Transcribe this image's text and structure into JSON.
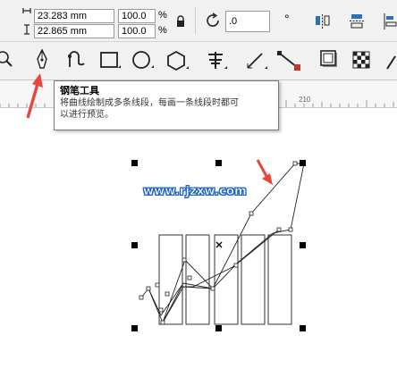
{
  "property_bar": {
    "width_value": "23.283 mm",
    "height_value": "22.865 mm",
    "scale_x": "100.0",
    "scale_y": "100.0",
    "percent_x": "%",
    "percent_y": "%",
    "rotation_value": ".0",
    "degree_symbol": "°"
  },
  "toolbox": {
    "tools": [
      "zoom-tool",
      "pen-tool",
      "bspline-tool",
      "rectangle-tool",
      "ellipse-tool",
      "polygon-tool",
      "text-tool",
      "parallel-dimension-tool",
      "connector-tool",
      "drop-shadow-tool",
      "transparency-tool"
    ],
    "active_tool": "pen-tool"
  },
  "tooltip": {
    "title": "钢笔工具",
    "description_line1": "将曲线绘制成多条线段，每画一条线段时都可",
    "description_line2": "以进行预览。"
  },
  "ruler": {
    "label_210": "210"
  },
  "canvas": {
    "watermark": "www.rjzxw.com",
    "annotation_color": "#e8463c"
  }
}
